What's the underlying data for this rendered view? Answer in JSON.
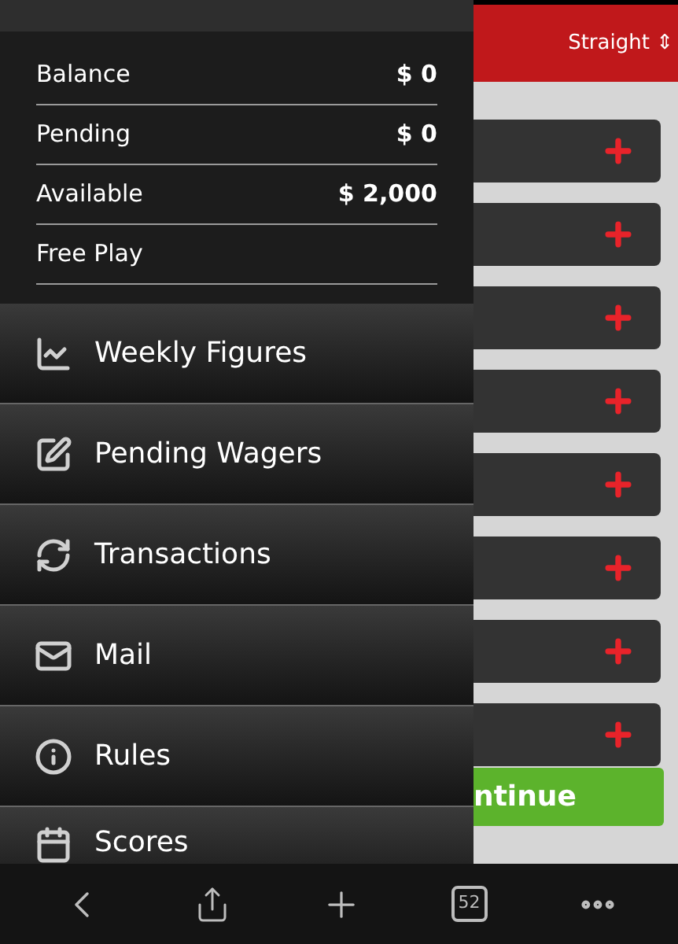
{
  "header": {
    "bet_type": "Straight",
    "bet_type_icon": "⇕"
  },
  "account": [
    {
      "label": "Balance",
      "value": "$ 0"
    },
    {
      "label": "Pending",
      "value": "$ 0"
    },
    {
      "label": "Available",
      "value": "$ 2,000"
    },
    {
      "label": "Free Play"
    }
  ],
  "menu": [
    {
      "label": "Weekly Figures"
    },
    {
      "label": "Pending Wagers"
    },
    {
      "label": "Transactions"
    },
    {
      "label": "Mail"
    },
    {
      "label": "Rules"
    },
    {
      "label": "Scores"
    }
  ],
  "continue_button": "ntinue",
  "browser_bar": {
    "tab_count": "52"
  }
}
